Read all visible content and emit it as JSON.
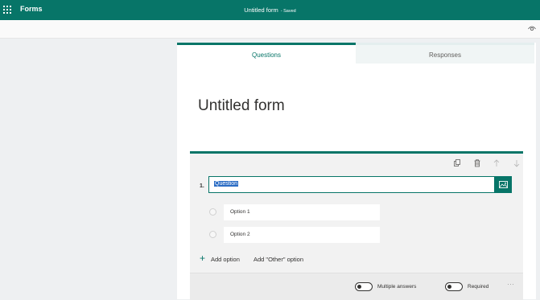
{
  "header": {
    "app_name": "Forms",
    "doc_title": "Untitled form",
    "save_status": "- Saved",
    "accent_color": "#077568"
  },
  "subbar": {
    "preview_icon": "eye-icon"
  },
  "tabs": [
    {
      "label": "Questions",
      "active": true
    },
    {
      "label": "Responses",
      "active": false
    }
  ],
  "form": {
    "title": "Untitled form"
  },
  "question": {
    "number": "1.",
    "text": "Question",
    "options": [
      {
        "label": "Option 1"
      },
      {
        "label": "Option 2"
      }
    ],
    "add_option_label": "Add option",
    "add_other_label": "Add \"Other\" option",
    "toolbar_icons": [
      "copy-icon",
      "trash-icon",
      "arrow-up-icon",
      "arrow-down-icon"
    ],
    "multiple_answers_label": "Multiple answers",
    "required_label": "Required",
    "more_label": "···"
  }
}
